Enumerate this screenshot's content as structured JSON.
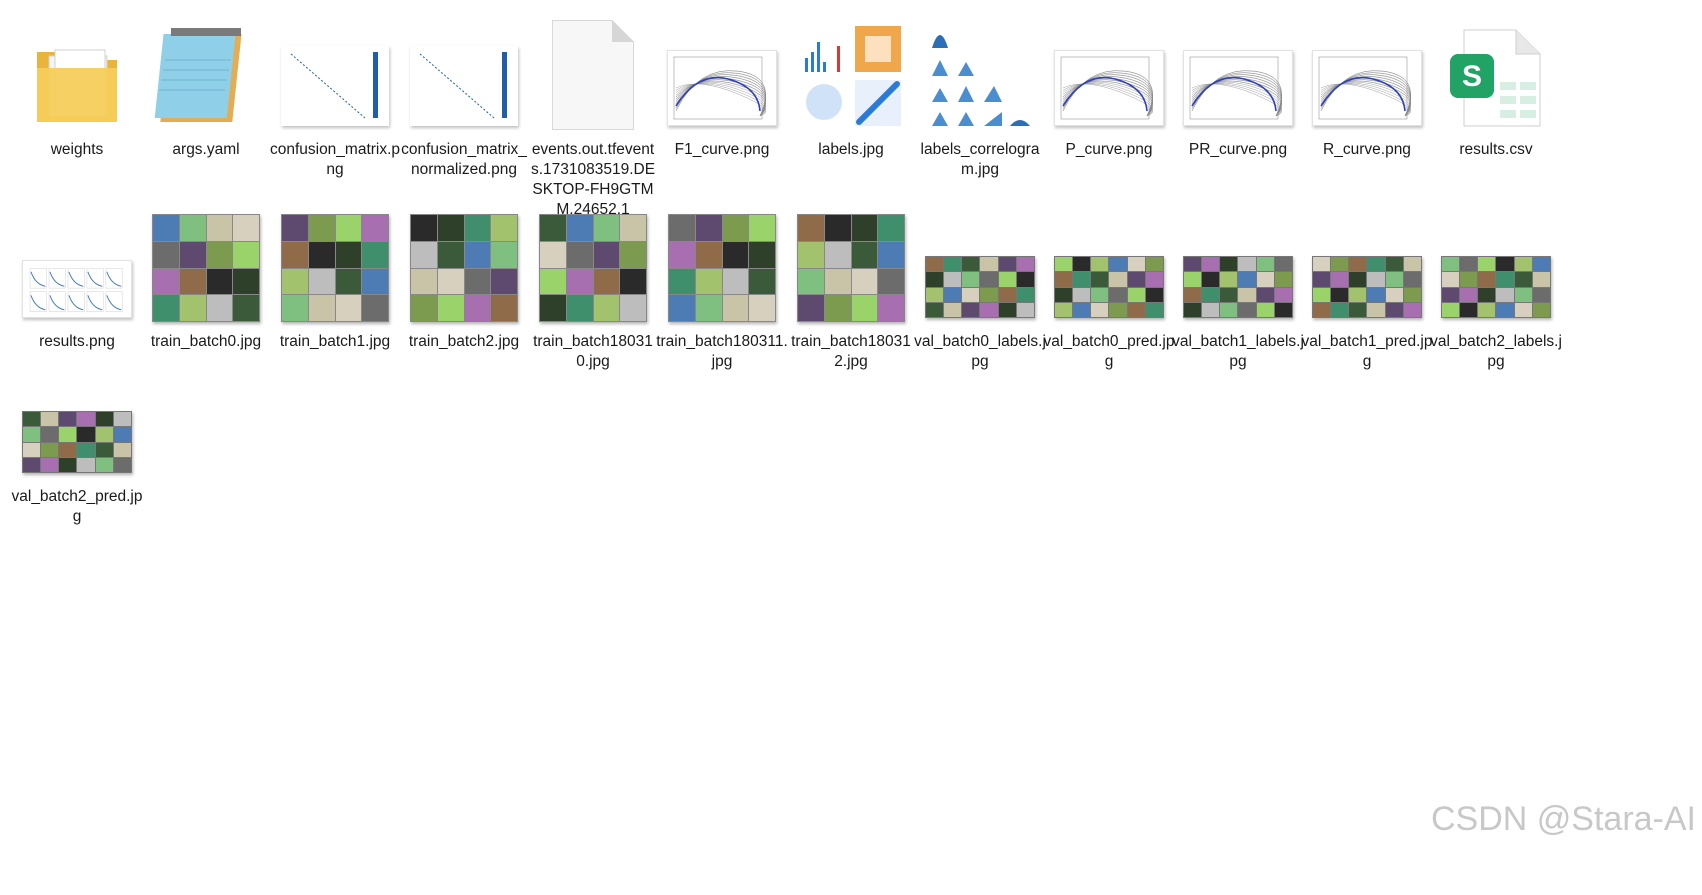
{
  "files": [
    {
      "id": "weights",
      "name": "weights",
      "kind": "folder"
    },
    {
      "id": "args",
      "name": "args.yaml",
      "kind": "notepad"
    },
    {
      "id": "cm",
      "name": "confusion_matrix.png",
      "kind": "matrix"
    },
    {
      "id": "cmn",
      "name": "confusion_matrix_normalized.png",
      "kind": "matrix"
    },
    {
      "id": "events",
      "name": "events.out.tfevents.1731083519.DESKTOP-FH9GTMM.24652.1",
      "kind": "blank"
    },
    {
      "id": "f1",
      "name": "F1_curve.png",
      "kind": "curve"
    },
    {
      "id": "labels",
      "name": "labels.jpg",
      "kind": "labels"
    },
    {
      "id": "labcorr",
      "name": "labels_correlogram.jpg",
      "kind": "correlogram"
    },
    {
      "id": "p",
      "name": "P_curve.png",
      "kind": "curve"
    },
    {
      "id": "pr",
      "name": "PR_curve.png",
      "kind": "curve"
    },
    {
      "id": "r",
      "name": "R_curve.png",
      "kind": "curve"
    },
    {
      "id": "csv",
      "name": "results.csv",
      "kind": "csv",
      "badge": "S"
    },
    {
      "id": "respng",
      "name": "results.png",
      "kind": "results"
    },
    {
      "id": "tb0",
      "name": "train_batch0.jpg",
      "kind": "photo"
    },
    {
      "id": "tb1",
      "name": "train_batch1.jpg",
      "kind": "photo"
    },
    {
      "id": "tb2",
      "name": "train_batch2.jpg",
      "kind": "photo"
    },
    {
      "id": "tb180310",
      "name": "train_batch180310.jpg",
      "kind": "photo"
    },
    {
      "id": "tb180311",
      "name": "train_batch180311.jpg",
      "kind": "photo"
    },
    {
      "id": "tb180312",
      "name": "train_batch180312.jpg",
      "kind": "photo"
    },
    {
      "id": "vb0l",
      "name": "val_batch0_labels.jpg",
      "kind": "wide"
    },
    {
      "id": "vb0p",
      "name": "val_batch0_pred.jpg",
      "kind": "wide"
    },
    {
      "id": "vb1l",
      "name": "val_batch1_labels.jpg",
      "kind": "wide"
    },
    {
      "id": "vb1p",
      "name": "val_batch1_pred.jpg",
      "kind": "wide"
    },
    {
      "id": "vb2l",
      "name": "val_batch2_labels.jpg",
      "kind": "wide"
    },
    {
      "id": "vb2p",
      "name": "val_batch2_pred.jpg",
      "kind": "wide"
    }
  ],
  "watermark": "CSDN @Stara-AI",
  "colors": {
    "folder": "#f2c14e",
    "curve_line": "#2b3fbf",
    "matrix_blue": "#1f5fa8",
    "csv_green": "#21a366"
  }
}
